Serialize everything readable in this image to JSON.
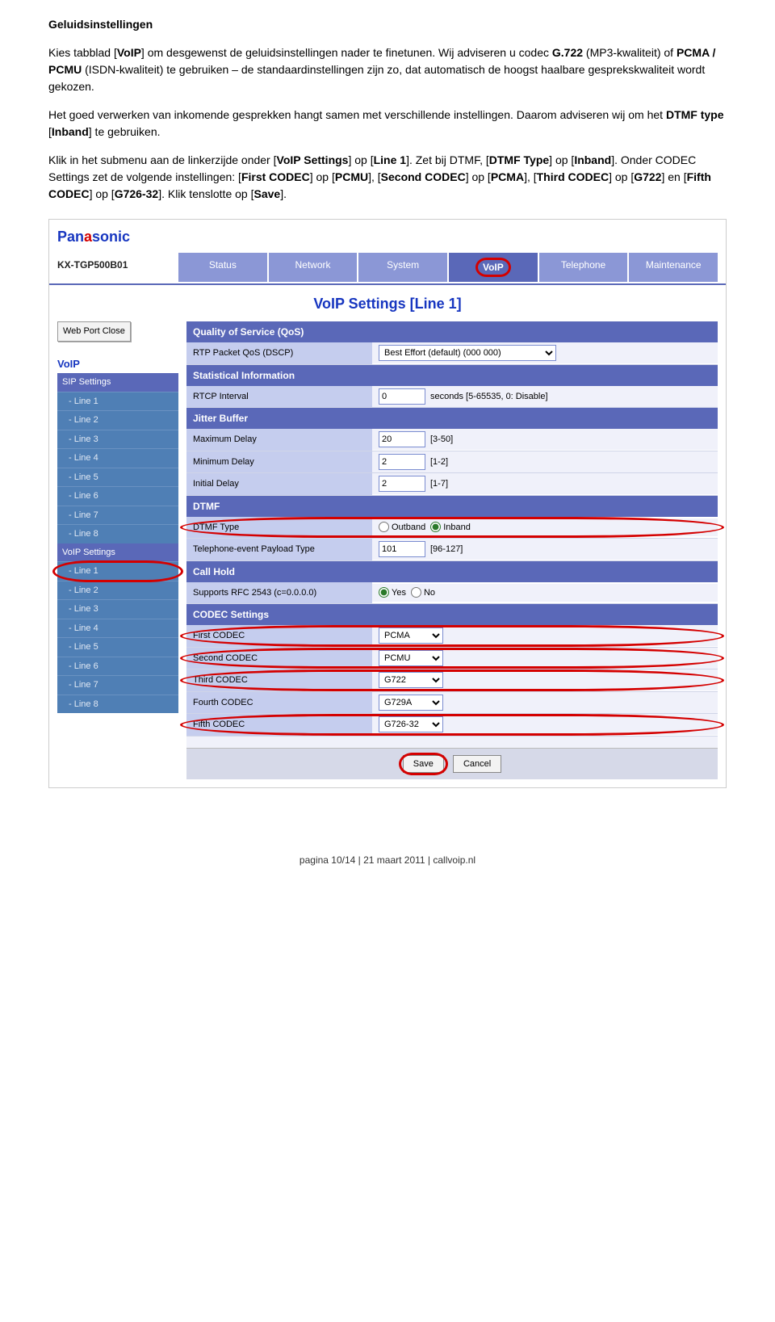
{
  "doc": {
    "heading": "Geluidsinstellingen",
    "p1_a": "Kies tabblad [",
    "p1_b": "VoIP",
    "p1_c": "] om desgewenst de geluidsinstellingen nader te finetunen. Wij adviseren u codec ",
    "p1_d": "G.722",
    "p1_e": " (MP3-kwaliteit) of ",
    "p1_f": "PCMA / PCMU",
    "p1_g": " (ISDN-kwaliteit) te gebruiken – de standaardinstellingen zijn zo, dat automatisch de hoogst haalbare gesprekskwaliteit wordt gekozen.",
    "p2_a": "Het goed verwerken van inkomende gesprekken hangt samen met verschillende instellingen. Daarom adviseren wij om het ",
    "p2_b": "DTMF type",
    "p2_c": " [",
    "p2_d": "Inband",
    "p2_e": "] te gebruiken.",
    "p3_a": "Klik in het submenu aan de linkerzijde onder [",
    "p3_b": "VoIP Settings",
    "p3_c": "] op [",
    "p3_d": "Line 1",
    "p3_e": "]. Zet bij DTMF, [",
    "p3_f": "DTMF Type",
    "p3_g": "] op [",
    "p3_h": "Inband",
    "p3_i": "]. Onder CODEC Settings zet de volgende instellingen: [",
    "p3_j": "First CODEC",
    "p3_k": "] op [",
    "p3_l": "PCMU",
    "p3_m": "], [",
    "p3_n": "Second CODEC",
    "p3_o": "] op [",
    "p3_p": "PCMA",
    "p3_q": "], [",
    "p3_r": "Third CODEC",
    "p3_s": "] op [",
    "p3_t": "G722",
    "p3_u": "] en [",
    "p3_v": "Fifth CODEC",
    "p3_w": "] op [",
    "p3_x": "G726-32",
    "p3_y": "]. Klik tenslotte op [",
    "p3_z": "Save",
    "p3_end": "]."
  },
  "ui": {
    "logo_a": "Pan",
    "logo_b": "a",
    "logo_c": "sonic",
    "model": "KX-TGP500B01",
    "tabs": {
      "status": "Status",
      "network": "Network",
      "system": "System",
      "voip": "VoIP",
      "telephone": "Telephone",
      "maintenance": "Maintenance"
    },
    "title": "VoIP Settings [Line 1]",
    "webport": "Web Port Close",
    "side": {
      "voip": "VoIP",
      "sip": "SIP Settings",
      "voipset": "VoIP Settings",
      "lines": [
        "- Line 1",
        "- Line 2",
        "- Line 3",
        "- Line 4",
        "- Line 5",
        "- Line 6",
        "- Line 7",
        "- Line 8"
      ]
    },
    "sects": {
      "qos": "Quality of Service (QoS)",
      "stat": "Statistical Information",
      "jitter": "Jitter Buffer",
      "dtmf": "DTMF",
      "hold": "Call Hold",
      "codec": "CODEC Settings"
    },
    "rows": {
      "rtp_l": "RTP Packet QoS (DSCP)",
      "rtp_v": "Best Effort (default) (000 000)",
      "rtcp_l": "RTCP Interval",
      "rtcp_v": "0",
      "rtcp_s": "seconds [5-65535, 0: Disable]",
      "maxd_l": "Maximum Delay",
      "maxd_v": "20",
      "maxd_s": "[3-50]",
      "mind_l": "Minimum Delay",
      "mind_v": "2",
      "mind_s": "[1-2]",
      "inid_l": "Initial Delay",
      "inid_v": "2",
      "inid_s": "[1-7]",
      "dtmft_l": "DTMF Type",
      "dtmft_out": "Outband",
      "dtmft_in": "Inband",
      "tel_l": "Telephone-event Payload Type",
      "tel_v": "101",
      "tel_s": "[96-127]",
      "rfc_l": "Supports RFC 2543 (c=0.0.0.0)",
      "rfc_yes": "Yes",
      "rfc_no": "No",
      "c1_l": "First CODEC",
      "c1_v": "PCMA",
      "c2_l": "Second CODEC",
      "c2_v": "PCMU",
      "c3_l": "Third CODEC",
      "c3_v": "G722",
      "c4_l": "Fourth CODEC",
      "c4_v": "G729A",
      "c5_l": "Fifth CODEC",
      "c5_v": "G726-32"
    },
    "btn_save": "Save",
    "btn_cancel": "Cancel"
  },
  "footer": "pagina 10/14  |  21 maart 2011  |  callvoip.nl"
}
